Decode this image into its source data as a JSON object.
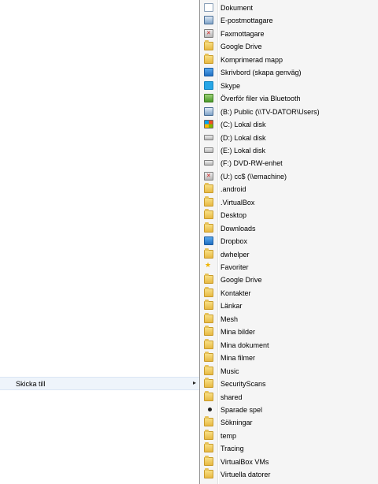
{
  "context_menu": {
    "send_to_label": "Skicka till",
    "send_to_arrow": "▸"
  },
  "submenu": {
    "items": [
      {
        "label": "Dokument",
        "icon": "document-icon"
      },
      {
        "label": "E-postmottagare",
        "icon": "mail-recipient-icon"
      },
      {
        "label": "Faxmottagare",
        "icon": "fax-icon"
      },
      {
        "label": "Google Drive",
        "icon": "google-drive-folder-icon"
      },
      {
        "label": "Komprimerad mapp",
        "icon": "zip-folder-icon"
      },
      {
        "label": "Skrivbord (skapa genväg)",
        "icon": "desktop-icon"
      },
      {
        "label": "Skype",
        "icon": "skype-icon"
      },
      {
        "label": "Överför filer via Bluetooth",
        "icon": "bluetooth-icon"
      },
      {
        "label": "(B:) Public (\\\\TV-DATOR\\Users)",
        "icon": "network-drive-icon"
      },
      {
        "label": "(C:) Lokal disk",
        "icon": "system-drive-icon"
      },
      {
        "label": "(D:) Lokal disk",
        "icon": "drive-icon"
      },
      {
        "label": "(E:) Lokal disk",
        "icon": "drive-icon"
      },
      {
        "label": "(F:) DVD-RW-enhet",
        "icon": "dvd-drive-icon"
      },
      {
        "label": "(U:) cc$ (\\\\emachine)",
        "icon": "disconnected-drive-icon"
      },
      {
        "label": ".android",
        "icon": "folder-icon"
      },
      {
        "label": ".VirtualBox",
        "icon": "folder-icon"
      },
      {
        "label": "Desktop",
        "icon": "desktop-folder-icon"
      },
      {
        "label": "Downloads",
        "icon": "downloads-folder-icon"
      },
      {
        "label": "Dropbox",
        "icon": "dropbox-icon"
      },
      {
        "label": "dwhelper",
        "icon": "folder-icon"
      },
      {
        "label": "Favoriter",
        "icon": "favorites-icon"
      },
      {
        "label": "Google Drive",
        "icon": "google-drive-folder-icon"
      },
      {
        "label": "Kontakter",
        "icon": "contacts-folder-icon"
      },
      {
        "label": "Länkar",
        "icon": "links-folder-icon"
      },
      {
        "label": "Mesh",
        "icon": "folder-icon"
      },
      {
        "label": "Mina bilder",
        "icon": "pictures-folder-icon"
      },
      {
        "label": "Mina dokument",
        "icon": "documents-folder-icon"
      },
      {
        "label": "Mina filmer",
        "icon": "videos-folder-icon"
      },
      {
        "label": "Music",
        "icon": "music-folder-icon"
      },
      {
        "label": "SecurityScans",
        "icon": "folder-icon"
      },
      {
        "label": "shared",
        "icon": "folder-icon"
      },
      {
        "label": "Sparade spel",
        "icon": "saved-games-folder-icon"
      },
      {
        "label": "Sökningar",
        "icon": "searches-folder-icon"
      },
      {
        "label": "temp",
        "icon": "folder-icon"
      },
      {
        "label": "Tracing",
        "icon": "folder-icon"
      },
      {
        "label": "VirtualBox VMs",
        "icon": "folder-icon"
      },
      {
        "label": "Virtuella datorer",
        "icon": "virtual-machines-folder-icon"
      }
    ]
  }
}
